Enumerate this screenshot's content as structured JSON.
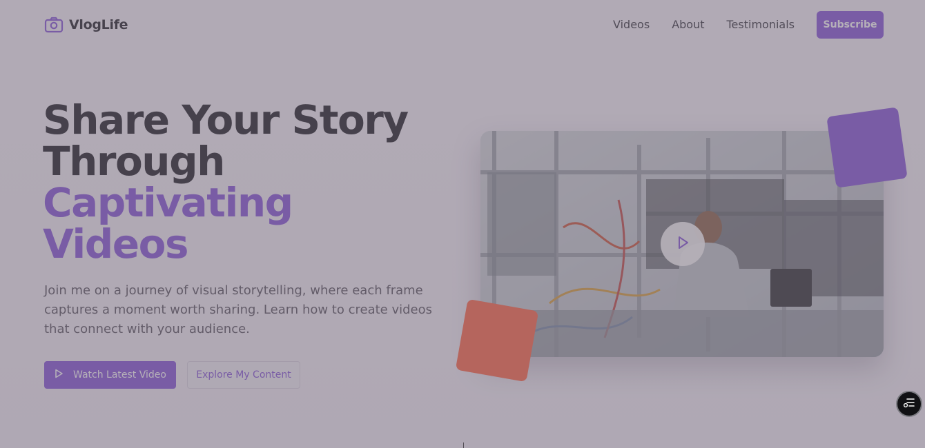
{
  "brand": {
    "name": "VlogLife",
    "icon": "camera-icon"
  },
  "nav": {
    "links": [
      "Videos",
      "About",
      "Testimonials"
    ],
    "subscribe_label": "Subscribe"
  },
  "hero": {
    "title_lines": [
      "Share Your Story",
      "Through"
    ],
    "title_accent_lines": [
      "Captivating",
      "Videos"
    ],
    "description": "Join me on a journey of visual storytelling, where each frame captures a moment worth sharing. Learn how to create videos that connect with your audience.",
    "primary_button": "Watch Latest Video",
    "secondary_button": "Explore My Content"
  },
  "media": {
    "play_icon": "play-icon"
  },
  "colors": {
    "accent": "#7a45d6",
    "coral": "#ff5a36",
    "overlay": "rgba(120,112,126,0.55)"
  },
  "chat": {
    "icon": "chat-icon"
  }
}
